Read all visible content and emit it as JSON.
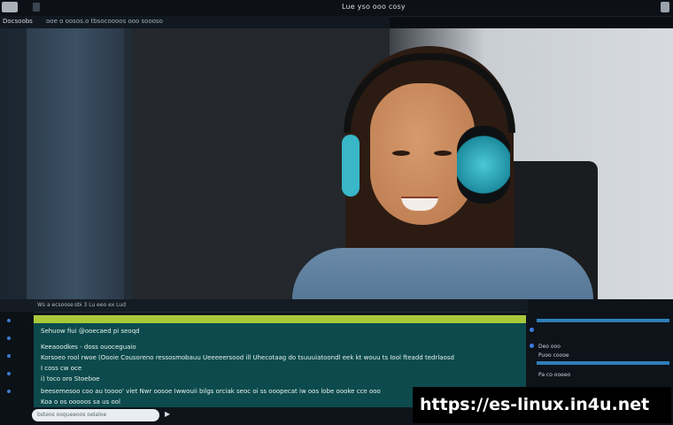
{
  "topbar": {
    "title": "Lue yso ooo cosy"
  },
  "subbar": {
    "left": "Docsoobs",
    "right": "ooe o oosos.o tbsocoooos ooo soooso"
  },
  "panel": {
    "header": [
      "Ws a ecsoose",
      "sbi 3 Lu eeo ex Lud"
    ],
    "lines": [
      "Sehuow fiui @ooecaed pi seoqd",
      "Keeaoodkes - doss ouoceguaio",
      "Korsoeo rool rwoe  (Oooie Cousoreno ressosmobauu   Ueeeeersood ill  Uhecotaag  do tsuuuiatoondl eek kt  wouu ts Iool fteadd tedrlaosd",
      "I coss cw oce",
      "i) toco oro    Stoeboe",
      "beesemesoo coo au toooo' viet  Nwr oosoe Iwwouii bilgs orciak  seoc oi  ss ooopecat iw oos lobe oooke cce ooo",
      "Koa o os ooooos sa us ool"
    ],
    "side": [
      "Deo ooo",
      "Puoo coooe",
      "Pa co ooeeo"
    ],
    "input_placeholder": "bsteos ooqueeoos oelaloe",
    "url": "https://es-linux.in4u.net"
  }
}
